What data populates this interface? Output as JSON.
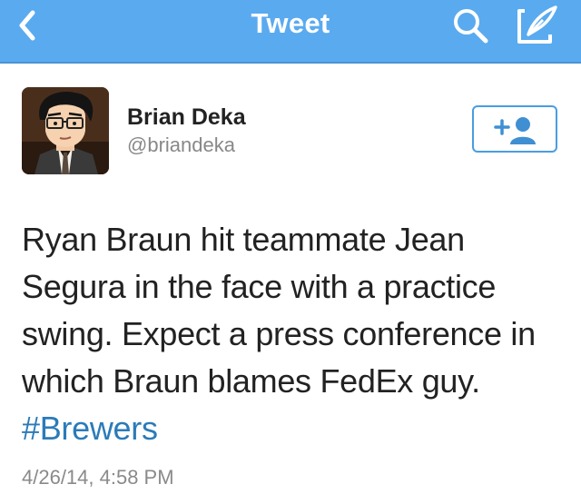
{
  "nav": {
    "title": "Tweet",
    "back_icon": "chevron-left-icon",
    "search_icon": "search-icon",
    "compose_icon": "compose-icon",
    "background": "#5aaaf0"
  },
  "user": {
    "name": "Brian Deka",
    "handle": "@briandeka",
    "follow_icon": "add-user-icon"
  },
  "tweet": {
    "text": "Ryan Braun hit teammate Jean Segura in the face with a practice swing. Expect a press conference in which Braun blames FedEx guy.",
    "hashtag": "#Brewers",
    "timestamp": "4/26/14, 4:58 PM"
  },
  "colors": {
    "accent": "#2b7bb9",
    "follow_border": "#4a9de0"
  }
}
